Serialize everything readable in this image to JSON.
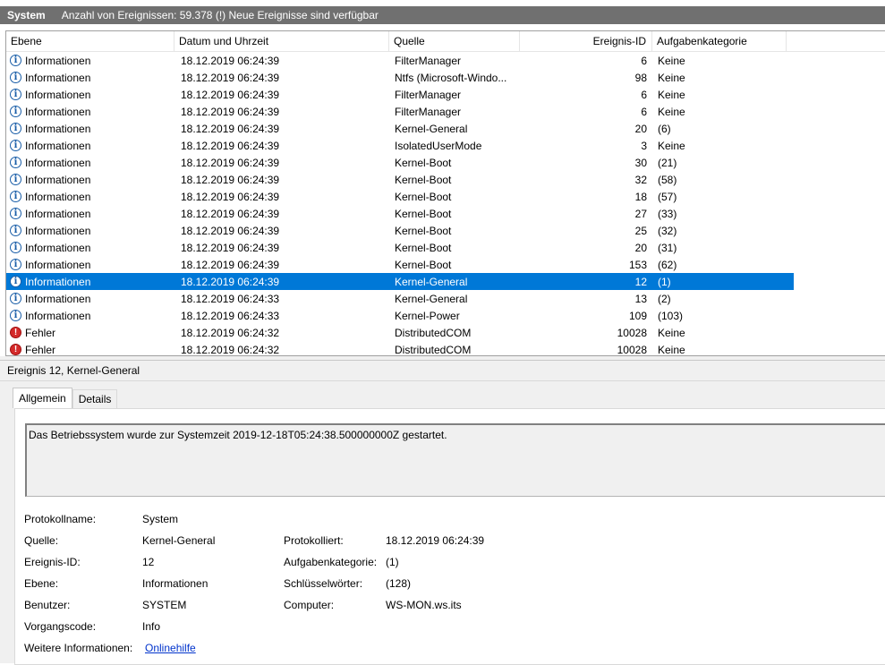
{
  "titlebar": {
    "title": "System",
    "status": "Anzahl von Ereignissen: 59.378 (!) Neue Ereignisse sind verfügbar"
  },
  "table": {
    "columns": [
      "Ebene",
      "Datum und Uhrzeit",
      "Quelle",
      "Ereignis-ID",
      "Aufgabenkategorie"
    ],
    "rows": [
      {
        "level": "Informationen",
        "icon": "info-icon",
        "date": "18.12.2019 06:24:39",
        "source": "FilterManager",
        "id": "6",
        "category": "Keine"
      },
      {
        "level": "Informationen",
        "icon": "info-icon",
        "date": "18.12.2019 06:24:39",
        "source": "Ntfs (Microsoft-Windo...",
        "id": "98",
        "category": "Keine"
      },
      {
        "level": "Informationen",
        "icon": "info-icon",
        "date": "18.12.2019 06:24:39",
        "source": "FilterManager",
        "id": "6",
        "category": "Keine"
      },
      {
        "level": "Informationen",
        "icon": "info-icon",
        "date": "18.12.2019 06:24:39",
        "source": "FilterManager",
        "id": "6",
        "category": "Keine"
      },
      {
        "level": "Informationen",
        "icon": "info-icon",
        "date": "18.12.2019 06:24:39",
        "source": "Kernel-General",
        "id": "20",
        "category": "(6)"
      },
      {
        "level": "Informationen",
        "icon": "info-icon",
        "date": "18.12.2019 06:24:39",
        "source": "IsolatedUserMode",
        "id": "3",
        "category": "Keine"
      },
      {
        "level": "Informationen",
        "icon": "info-icon",
        "date": "18.12.2019 06:24:39",
        "source": "Kernel-Boot",
        "id": "30",
        "category": "(21)"
      },
      {
        "level": "Informationen",
        "icon": "info-icon",
        "date": "18.12.2019 06:24:39",
        "source": "Kernel-Boot",
        "id": "32",
        "category": "(58)"
      },
      {
        "level": "Informationen",
        "icon": "info-icon",
        "date": "18.12.2019 06:24:39",
        "source": "Kernel-Boot",
        "id": "18",
        "category": "(57)"
      },
      {
        "level": "Informationen",
        "icon": "info-icon",
        "date": "18.12.2019 06:24:39",
        "source": "Kernel-Boot",
        "id": "27",
        "category": "(33)"
      },
      {
        "level": "Informationen",
        "icon": "info-icon",
        "date": "18.12.2019 06:24:39",
        "source": "Kernel-Boot",
        "id": "25",
        "category": "(32)"
      },
      {
        "level": "Informationen",
        "icon": "info-icon",
        "date": "18.12.2019 06:24:39",
        "source": "Kernel-Boot",
        "id": "20",
        "category": "(31)"
      },
      {
        "level": "Informationen",
        "icon": "info-icon",
        "date": "18.12.2019 06:24:39",
        "source": "Kernel-Boot",
        "id": "153",
        "category": "(62)"
      },
      {
        "level": "Informationen",
        "icon": "info-icon",
        "date": "18.12.2019 06:24:39",
        "source": "Kernel-General",
        "id": "12",
        "category": "(1)",
        "selected": true
      },
      {
        "level": "Informationen",
        "icon": "info-icon",
        "date": "18.12.2019 06:24:33",
        "source": "Kernel-General",
        "id": "13",
        "category": "(2)"
      },
      {
        "level": "Informationen",
        "icon": "info-icon",
        "date": "18.12.2019 06:24:33",
        "source": "Kernel-Power",
        "id": "109",
        "category": "(103)"
      },
      {
        "level": "Fehler",
        "icon": "error-icon",
        "date": "18.12.2019 06:24:32",
        "source": "DistributedCOM",
        "id": "10028",
        "category": "Keine"
      },
      {
        "level": "Fehler",
        "icon": "error-icon",
        "date": "18.12.2019 06:24:32",
        "source": "DistributedCOM",
        "id": "10028",
        "category": "Keine"
      }
    ]
  },
  "detail": {
    "title": "Ereignis 12, Kernel-General",
    "tabs": [
      "Allgemein",
      "Details"
    ],
    "description": "Das Betriebssystem wurde zur Systemzeit 2019-12-18T05:24:38.500000000Z gestartet.",
    "labels": {
      "log_name": "Protokollname:",
      "source": "Quelle:",
      "event_id": "Ereignis-ID:",
      "level": "Ebene:",
      "user": "Benutzer:",
      "opcode": "Vorgangscode:",
      "more_info": "Weitere Informationen:",
      "logged": "Protokolliert:",
      "task_category": "Aufgabenkategorie:",
      "keywords": "Schlüsselwörter:",
      "computer": "Computer:"
    },
    "values": {
      "log_name": "System",
      "source": "Kernel-General",
      "event_id": "12",
      "level": "Informationen",
      "user": "SYSTEM",
      "opcode": "Info",
      "more_info_link": "Onlinehilfe",
      "logged": "18.12.2019 06:24:39",
      "task_category": "(1)",
      "keywords": "(128)",
      "computer": "WS-MON.ws.its"
    }
  },
  "colors": {
    "titlebar": "#707070",
    "selection": "#0078d7",
    "info_icon": "#1a5ea8",
    "error_icon": "#d42a2a",
    "link": "#0033cc"
  }
}
